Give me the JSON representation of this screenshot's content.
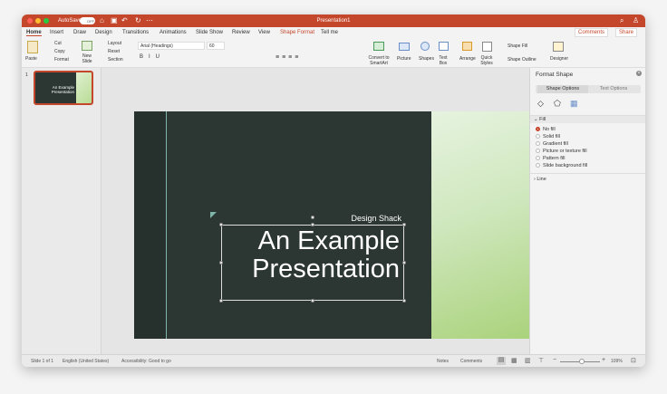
{
  "window": {
    "title": "Presentation1",
    "autosave_label": "AutoSave",
    "autosave_state": "OFF"
  },
  "tabs": [
    "Home",
    "Insert",
    "Draw",
    "Design",
    "Transitions",
    "Animations",
    "Slide Show",
    "Review",
    "View",
    "Shape Format",
    "Tell me"
  ],
  "active_tab": "Home",
  "header_buttons": {
    "comments": "Comments",
    "share": "Share"
  },
  "ribbon": {
    "paste": "Paste",
    "cut": "Cut",
    "copy": "Copy",
    "format": "Format",
    "new_slide": "New Slide",
    "layout": "Layout",
    "reset": "Reset",
    "section": "Section",
    "font": "Arial (Headings)",
    "font_size": "60",
    "convert": "Convert to SmartArt",
    "picture": "Picture",
    "shapes": "Shapes",
    "text_box": "Text Box",
    "arrange": "Arrange",
    "quick_styles": "Quick Styles",
    "shape_fill": "Shape Fill",
    "shape_outline": "Shape Outline",
    "designer": "Designer"
  },
  "thumbnail": {
    "number": "1",
    "title": "An Example Presentation"
  },
  "slide": {
    "subtitle": "Design Shack",
    "title_line1": "An Example",
    "title_line2": "Presentation"
  },
  "pane": {
    "title": "Format Shape",
    "tab_shape": "Shape Options",
    "tab_text": "Text Options",
    "fill_section": "Fill",
    "fill_options": [
      "No fill",
      "Solid fill",
      "Gradient fill",
      "Picture or texture fill",
      "Pattern fill",
      "Slide background fill"
    ],
    "selected_fill": "No fill",
    "line_section": "Line"
  },
  "status": {
    "slide": "Slide 1 of 1",
    "language": "English (United States)",
    "accessibility": "Accessibility: Good to go",
    "notes": "Notes",
    "comments": "Comments",
    "zoom": "109%"
  },
  "zoom_level": 0.55,
  "colors": {
    "accent": "#c4462b",
    "slide_dark": "#2c3733"
  }
}
